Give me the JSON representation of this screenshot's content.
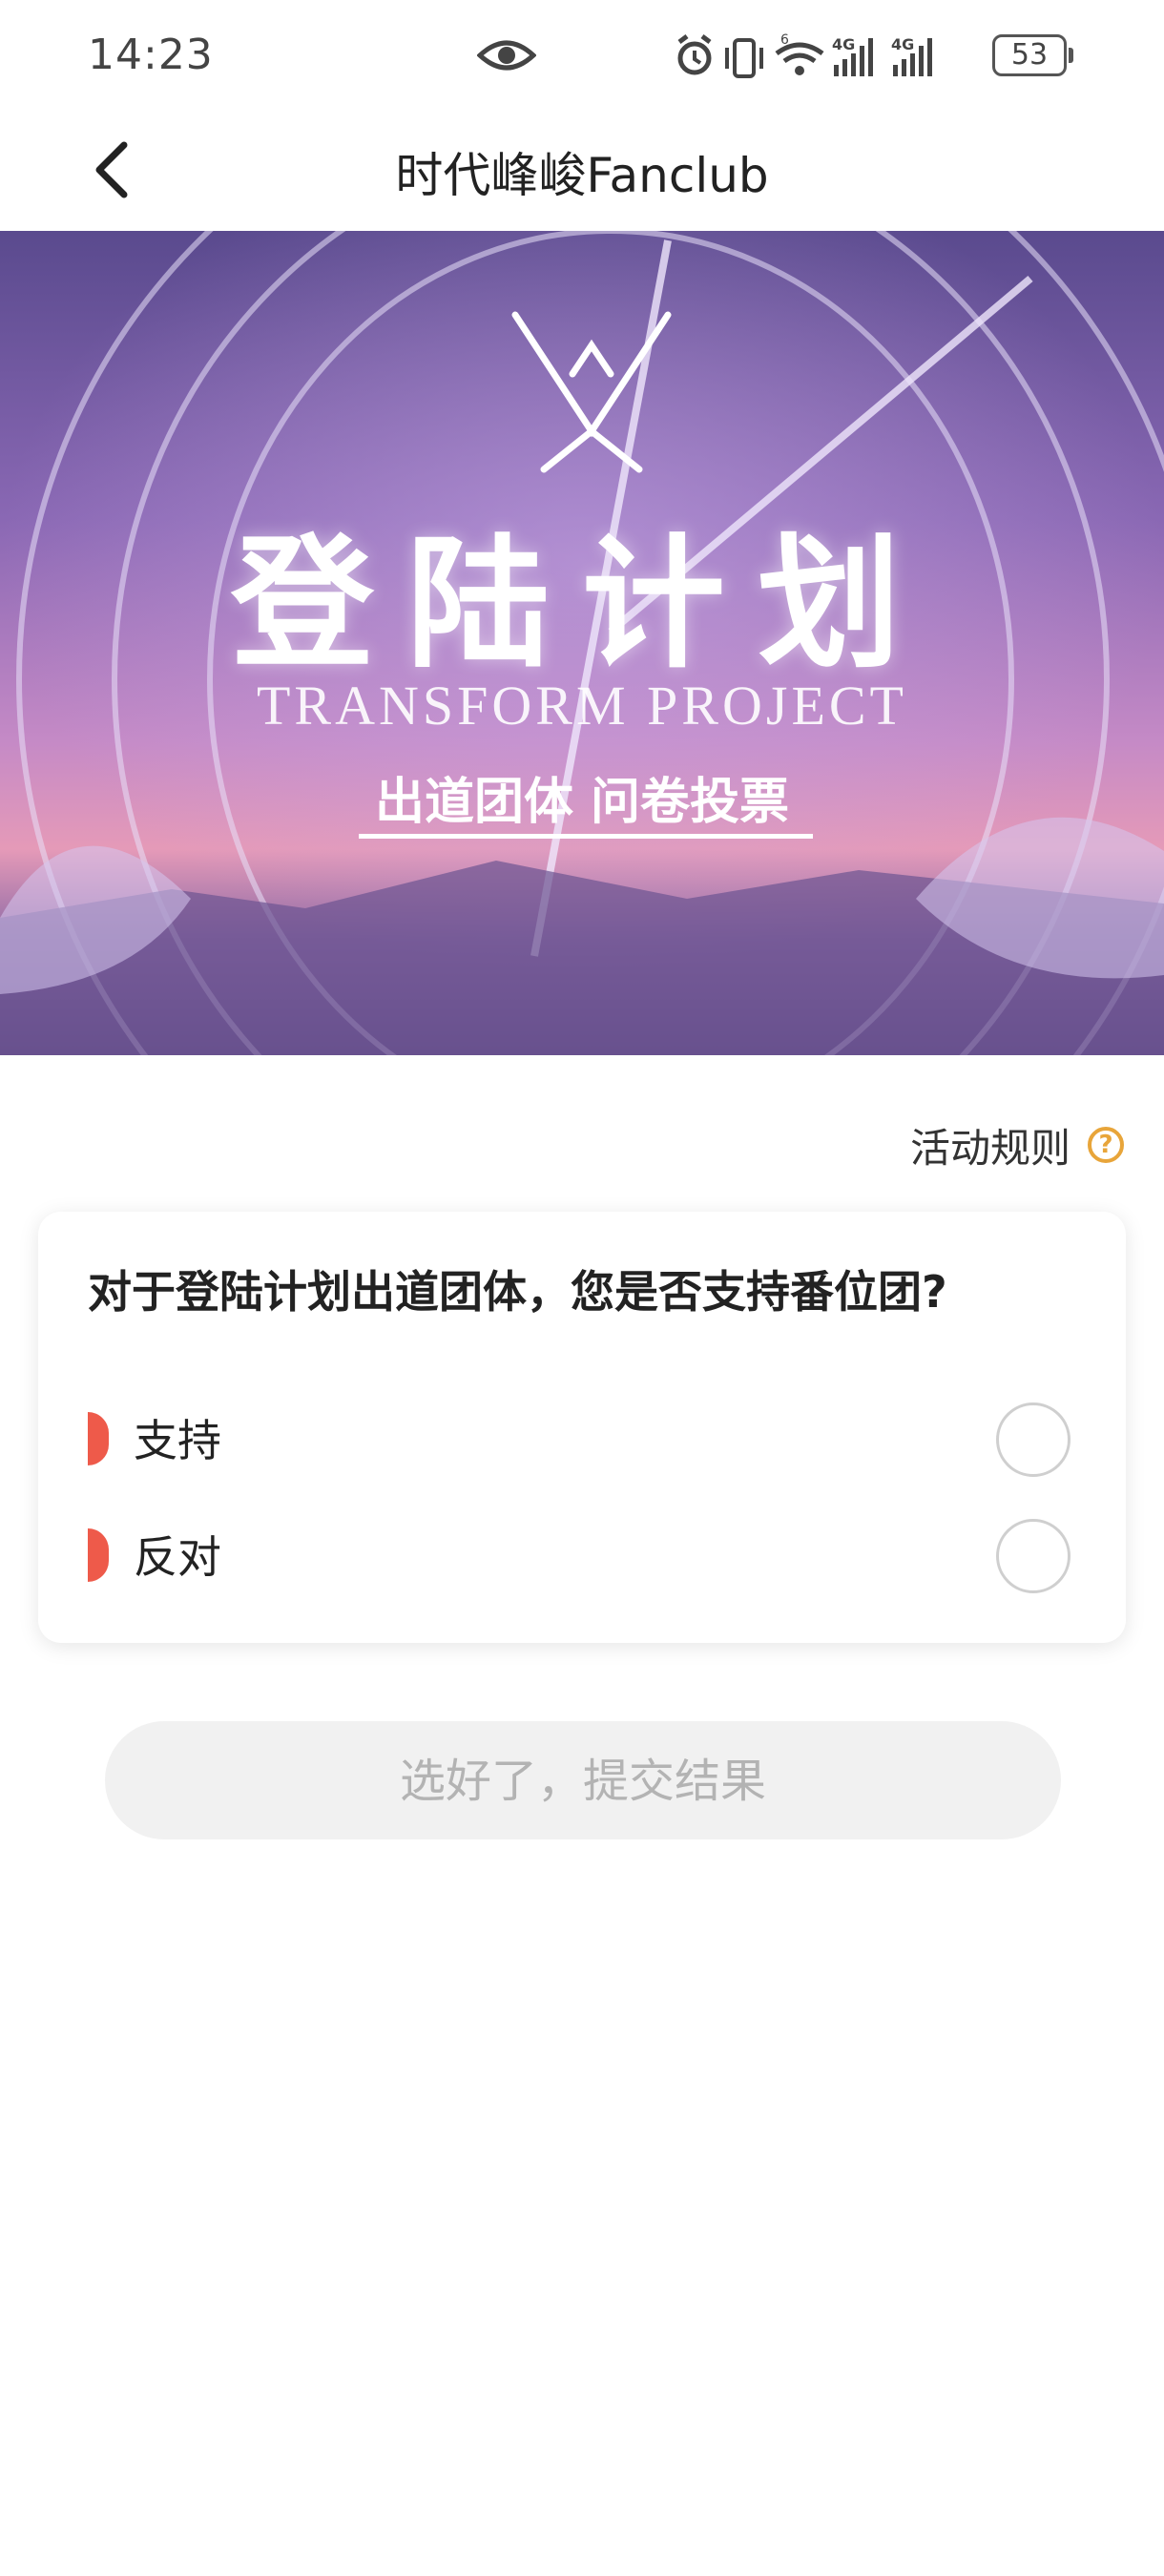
{
  "status_bar": {
    "time": "14:23",
    "battery": "53",
    "icons": [
      "eye-icon",
      "alarm-icon",
      "vibrate-icon",
      "wifi-icon",
      "signal-4g-icon",
      "signal-4g-icon"
    ]
  },
  "nav": {
    "title": "时代峰峻Fanclub",
    "back_icon": "chevron-left-icon"
  },
  "banner": {
    "title": "登陆计划",
    "subtitle": "TRANSFORM PROJECT",
    "tagline": "出道团体 问卷投票"
  },
  "rules": {
    "label": "活动规则",
    "icon": "question-circle-icon",
    "icon_char": "?"
  },
  "question": {
    "text": "对于登陆计划出道团体，您是否支持番位团?",
    "options": [
      {
        "label": "支持",
        "selected": false
      },
      {
        "label": "反对",
        "selected": false
      }
    ]
  },
  "submit": {
    "label": "选好了，提交结果",
    "enabled": false
  },
  "colors": {
    "accent_marker": "#ee5a4a",
    "help_icon": "#e8a53a",
    "submit_bg": "#f1f1f1",
    "submit_text": "#b3b3b3"
  }
}
